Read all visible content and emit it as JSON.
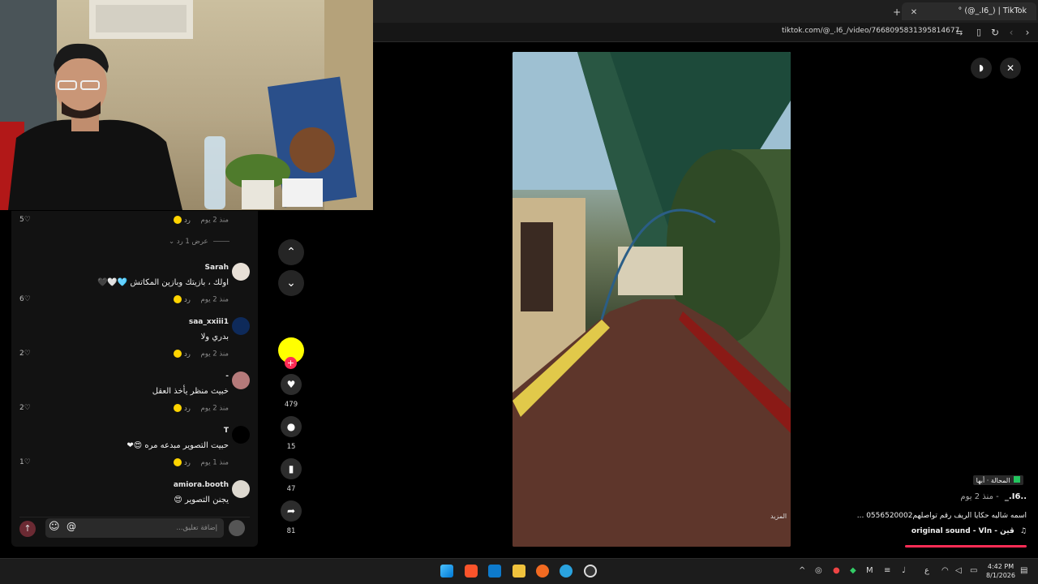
{
  "browser": {
    "tab_title": "° (@_.I6_) | TikTok",
    "new_tab_label": "+",
    "tab_close": "✕",
    "url": "tiktok.com/@_.I6_/video/7668095831395814677"
  },
  "comments": [
    {
      "author": "",
      "text": "",
      "time": "منذ 2 يوم",
      "reply": "رد",
      "likes": "5"
    },
    {
      "author": "Sarah",
      "text": "اولك ، بازيتك وبازين المكاتش 🩵🤍🖤",
      "time": "منذ 2 يوم",
      "reply": "رد",
      "likes": "6"
    },
    {
      "author": "saa_xxiii1",
      "text": "بدري ولا",
      "time": "منذ 2 يوم",
      "reply": "رد",
      "likes": "2"
    },
    {
      "author": "-",
      "text": "خبيث منظر يأخذ العقل",
      "time": "منذ 2 يوم",
      "reply": "رد",
      "likes": "2"
    },
    {
      "author": "T",
      "text": "حبيت التصوير مبدعه مره 😍❤",
      "time": "منذ 1 يوم",
      "reply": "رد",
      "likes": "1"
    },
    {
      "author": "amiora.booth",
      "text": "يجنن التصوير 😍",
      "time": "",
      "reply": "",
      "likes": ""
    }
  ],
  "view_replies": "عرض 1 رد",
  "comment_input_placeholder": "إضافة تعليق...",
  "at_label": "@",
  "rail": {
    "likes": "479",
    "comments": "15",
    "saves": "47",
    "shares": "81"
  },
  "video": {
    "author": "_.I6..",
    "time": "منذ 2 يوم -",
    "location": "المحالة · أبها",
    "caption": "اسمه شاليه حكايا الريف رقم تواصلهم0556520002 ...",
    "sound": "original sound - Vln - ڤين",
    "more": "المزيد"
  },
  "taskbar": {
    "time": "4:42 PM",
    "date": "8/1/2026",
    "lang": "ع"
  },
  "colors": {
    "accent": "#fe2c55",
    "emoji": "#ffd400"
  }
}
